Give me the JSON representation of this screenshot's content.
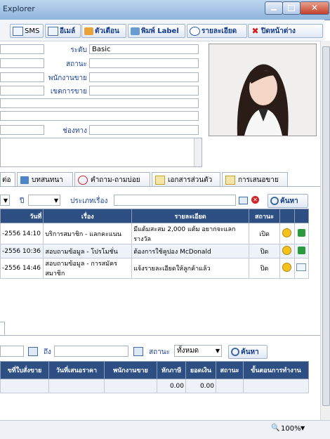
{
  "window": {
    "title": "Explorer"
  },
  "toolbar": {
    "sms": "SMS",
    "email": "อีเมล์",
    "remind": "ตัวเตือน",
    "print": "พิมพ์ Label",
    "detail": "รายละเอียด",
    "close": "ปิดหน้าต่าง"
  },
  "form": {
    "level_label": "ระดับ",
    "level_value": "Basic",
    "status_label": "สถานะ",
    "sales_label": "พนักงานขาย",
    "area_label": "เขตการขาย",
    "channel_label": "ช่องทาง"
  },
  "tabs": [
    "ต่อ",
    "บทสนทนา",
    "คำถาม-ถามบ่อย",
    "เอกสารส่วนตัว",
    "การเสนอขาย"
  ],
  "filter": {
    "year_label": "ปี",
    "type_label": "ประเภทเรื่อง",
    "search": "ค้นหา"
  },
  "issues": {
    "headers": [
      "วันที่",
      "เรื่อง",
      "รายละเอียด",
      "สถานะ"
    ],
    "rows": [
      {
        "date": "-2556 14:10",
        "subject": "บริการสมาชิก - แลกคะแนน",
        "detail": "มีแต้มสะสม 2,000 แต้ม อยากจะแลกรางวัล",
        "status": "เปิด"
      },
      {
        "date": "-2556 10:36",
        "subject": "สอบถามข้อมูล - โปรโมชั่น",
        "detail": "ต้องการใช้คูปอง McDonald",
        "status": "ปิด"
      },
      {
        "date": "-2556 14:46",
        "subject": "สอบถามข้อมูล - การสมัครสมาชิก",
        "detail": "แจ้งรายละเอียดให้ลูกค้าแล้ว",
        "status": "ปิด"
      }
    ]
  },
  "quote_filter": {
    "to_label": "ถึง",
    "status_label": "สถานะ",
    "status_value": "ทั้งหมด",
    "search": "ค้นหา"
  },
  "quotes": {
    "headers": [
      "ขที่ใบสั่งขาย",
      "วันที่เสนอราคา",
      "พนักงานขาย",
      "หักภาษี",
      "ยอดเงิน",
      "สถานะ",
      "ขั้นตอนการทำงาน"
    ],
    "total_tax": "0.00",
    "total_amount": "0.00"
  },
  "status": {
    "zoom": "100%"
  }
}
